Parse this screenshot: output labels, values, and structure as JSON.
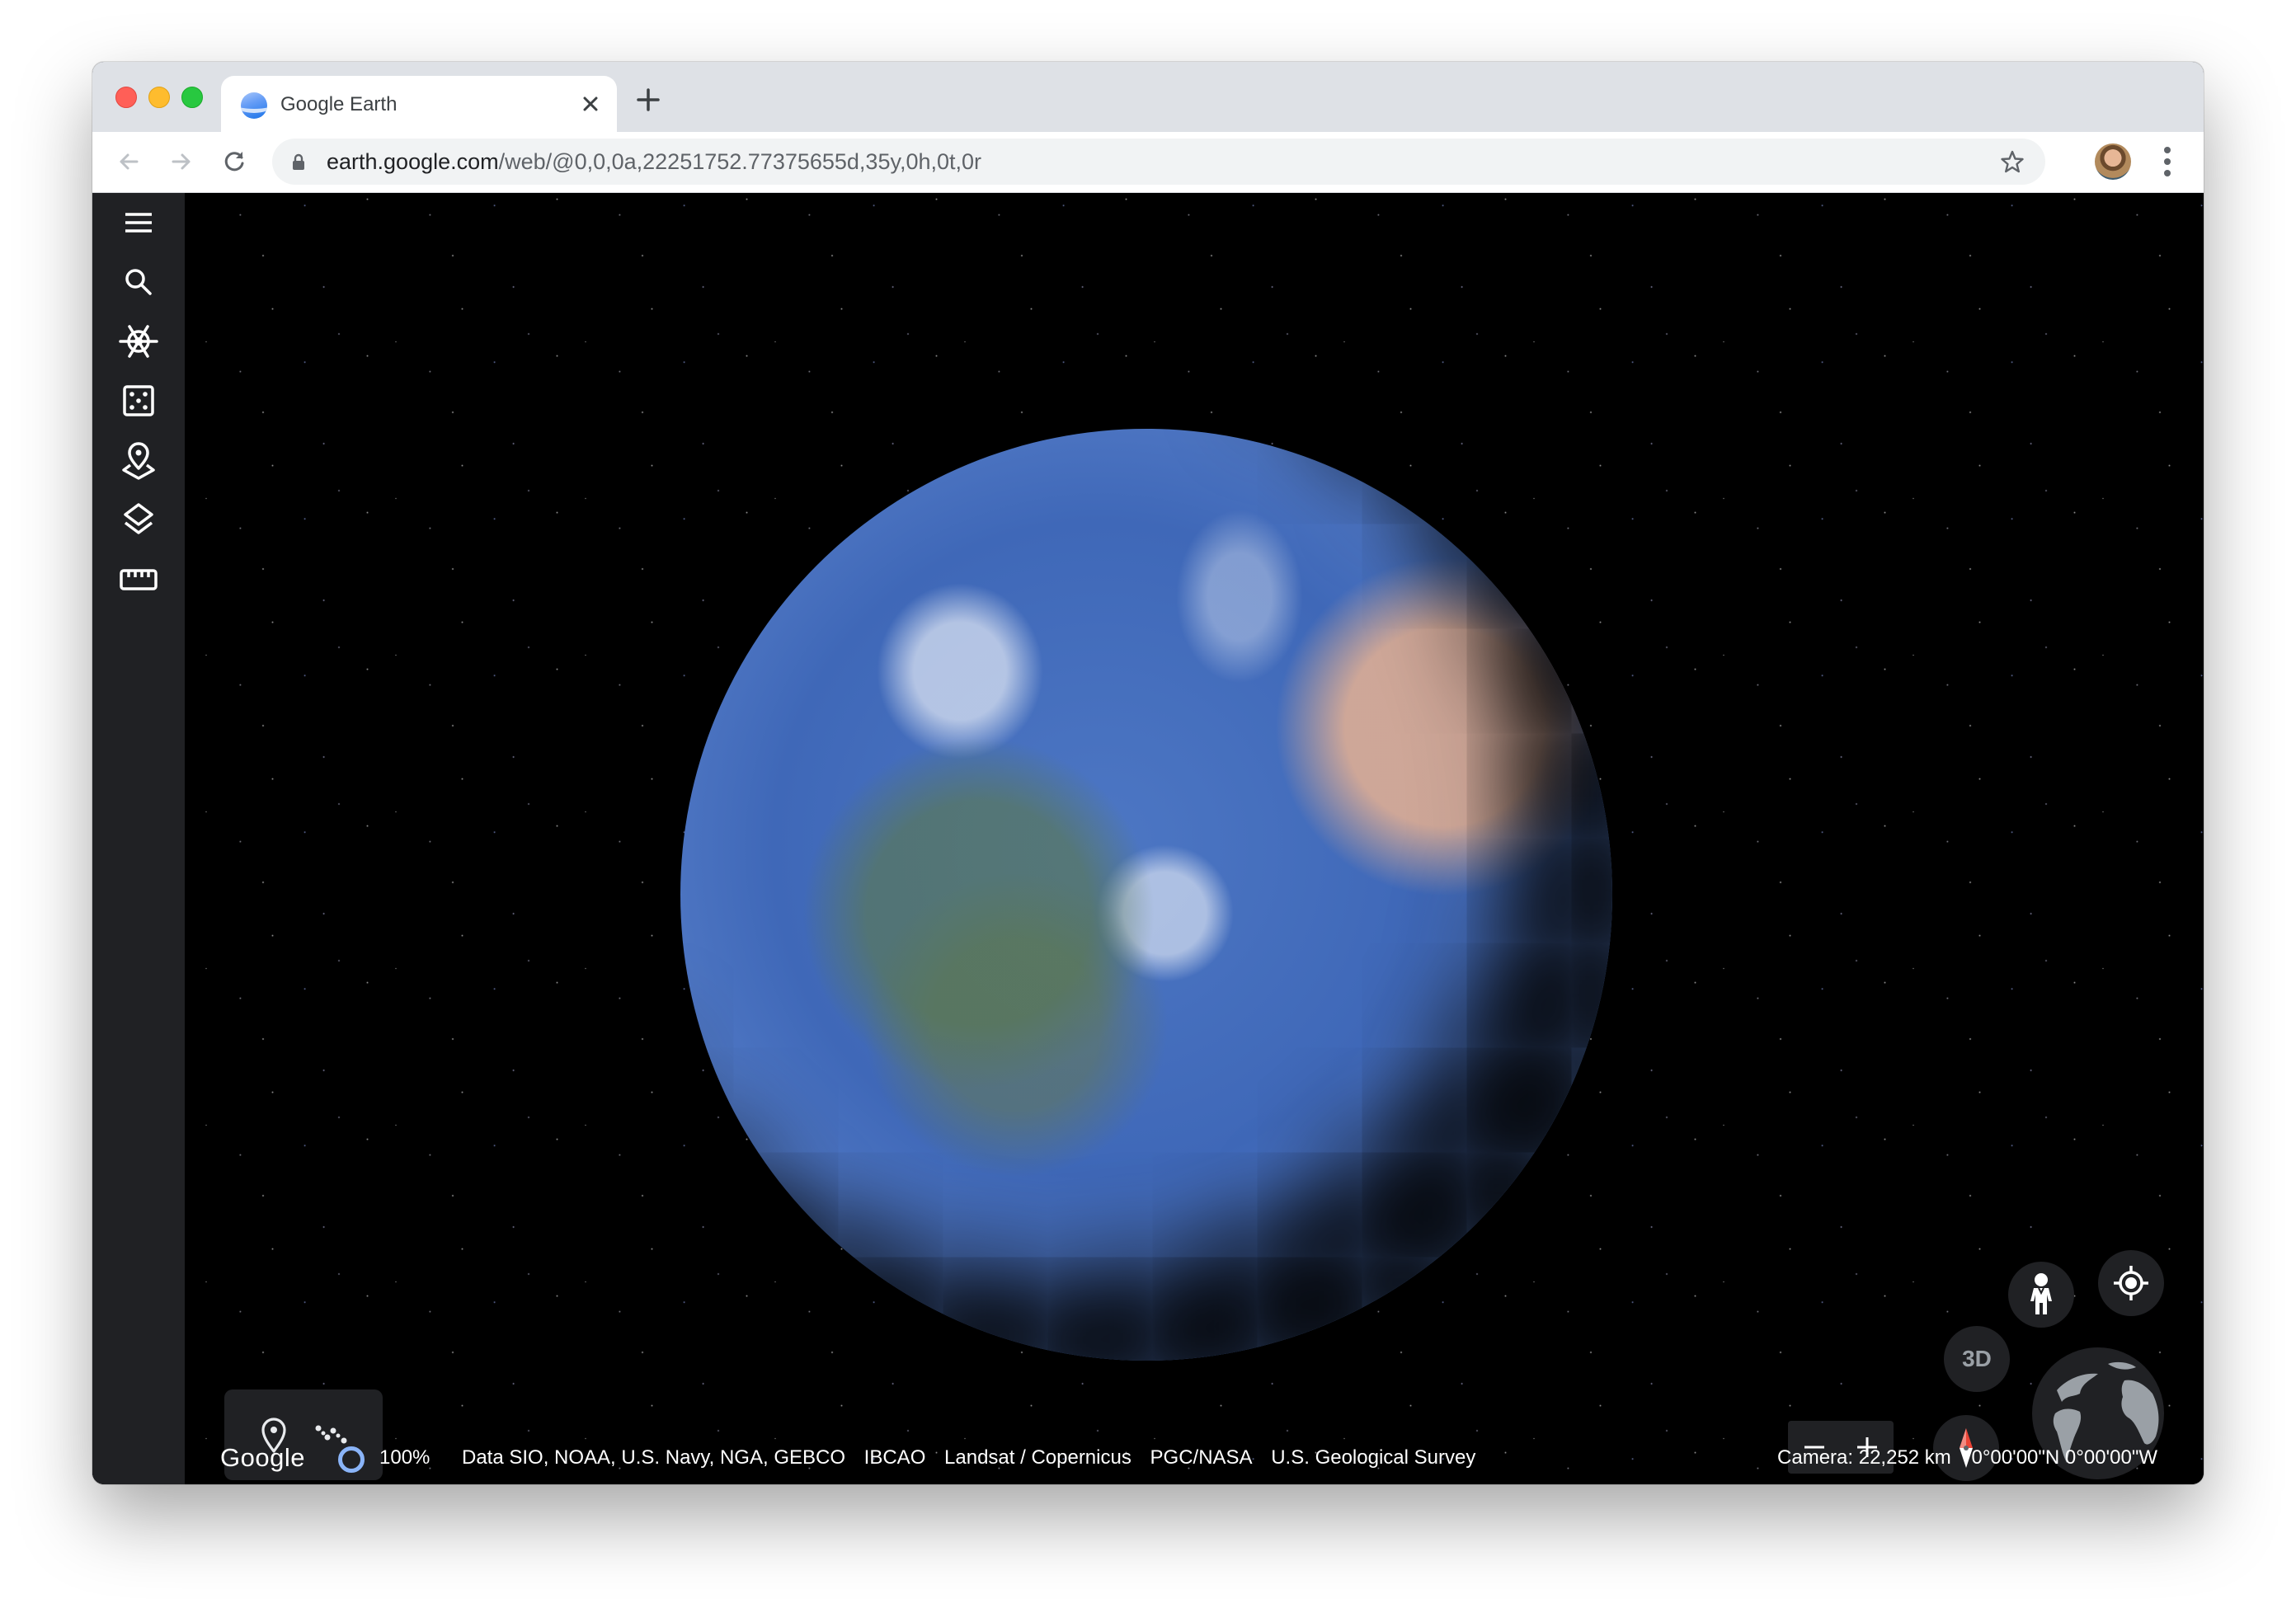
{
  "browser": {
    "tab": {
      "title": "Google Earth",
      "close_label": "×"
    },
    "new_tab_label": "+",
    "url": {
      "host": "earth.google.com",
      "path": "/web/@0,0,0a,22251752.77375655d,35y,0h,0t,0r"
    },
    "icons": {
      "back": "arrow-left-icon",
      "forward": "arrow-right-icon",
      "reload": "reload-icon",
      "lock": "lock-icon",
      "bookmark": "star-icon",
      "profile": "avatar",
      "menu": "kebab-menu-icon"
    }
  },
  "sidebar": {
    "items": [
      {
        "name": "menu",
        "icon": "hamburger-menu-icon"
      },
      {
        "name": "search",
        "icon": "search-icon"
      },
      {
        "name": "voyager",
        "icon": "ship-wheel-icon"
      },
      {
        "name": "feeling-lucky",
        "icon": "dice-icon"
      },
      {
        "name": "projects",
        "icon": "map-pin-layers-icon"
      },
      {
        "name": "map-style",
        "icon": "layers-icon"
      },
      {
        "name": "measure",
        "icon": "ruler-icon"
      }
    ]
  },
  "tools_panel": {
    "items": [
      {
        "name": "add-placemark",
        "icon": "map-pin-icon"
      },
      {
        "name": "draw-path",
        "icon": "path-dots-icon"
      }
    ]
  },
  "footer": {
    "logo": "Google",
    "loading_percent": "100%",
    "attributions": [
      "Data SIO, NOAA, U.S. Navy, NGA, GEBCO",
      "IBCAO",
      "Landsat / Copernicus",
      "PGC/NASA",
      "U.S. Geological Survey"
    ],
    "camera": "Camera: 22,252 km",
    "coordinates": "0°00'00\"N 0°00'00\"W"
  },
  "controls": {
    "toggle_3d": "3D",
    "zoom_out": "−",
    "zoom_in": "+"
  },
  "colors": {
    "sidebar_bg": "#202124",
    "control_bg": "#202124",
    "accent_blue": "#8ab4f8",
    "compass_red": "#ea4335",
    "tabstrip_bg": "#dee1e6"
  }
}
